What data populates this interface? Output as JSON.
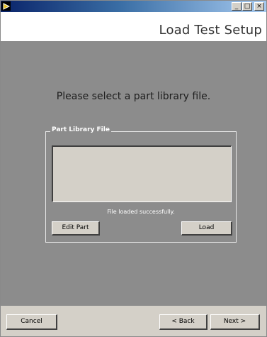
{
  "window": {
    "header_title": "Load Test Setup",
    "minimize_glyph": "_",
    "maximize_glyph": "□",
    "close_glyph": "×"
  },
  "main": {
    "prompt": "Please select a part library file.",
    "group_label": "Part Library File",
    "status": "File loaded successfully.",
    "edit_part_label": "Edit Part",
    "load_label": "Load"
  },
  "footer": {
    "cancel_label": "Cancel",
    "back_label": "< Back",
    "next_label": "Next >"
  },
  "colors": {
    "titlebar_start": "#0a246a",
    "panel_bg": "#8c8c8c",
    "button_face": "#d4d0c8"
  },
  "icons": {
    "app": "play-arrow-icon"
  }
}
